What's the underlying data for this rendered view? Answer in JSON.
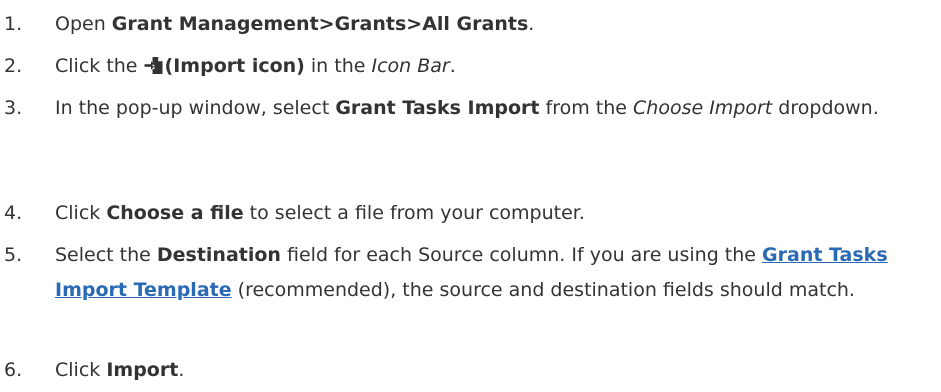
{
  "steps": [
    {
      "number": "1.",
      "pre": "Open ",
      "bold": "Grant Management>Grants>All Grants",
      "post": "."
    },
    {
      "number": "2.",
      "pre": "Click the ",
      "icon": "import-icon",
      "bold": "(Import icon)",
      "mid": " in the ",
      "italic": "Icon Bar",
      "post": "."
    },
    {
      "number": "3.",
      "pre": "In the pop-up window, select ",
      "bold": "Grant Tasks Import",
      "mid": " from the ",
      "italic": "Choose Import",
      "post": " dropdown."
    },
    {
      "number": "4.",
      "pre": "Click ",
      "bold": "Choose a file",
      "post": " to select a file from your computer."
    },
    {
      "number": "5.",
      "pre": "Select the ",
      "bold": "Destination",
      "mid": " field for each Source column. If you are using the ",
      "link": "Grant Tasks Import Template",
      "post": " (recommended), the source and destination fields should match."
    },
    {
      "number": "6.",
      "pre": "Click ",
      "bold": "Import",
      "post": "."
    }
  ],
  "colors": {
    "text": "#333333",
    "link": "#2a6ab5"
  }
}
